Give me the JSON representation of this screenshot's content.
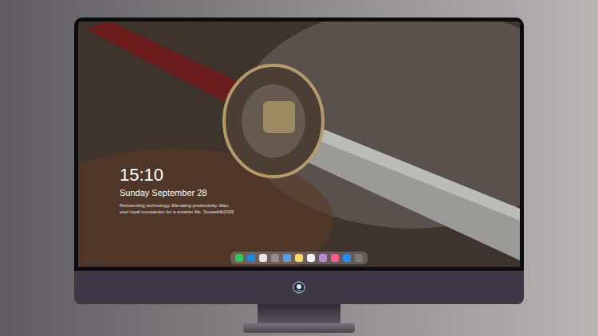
{
  "lock_screen": {
    "time": "15:10",
    "date": "Sunday September 28",
    "tagline": [
      "Reinventing technology. Elevating productivity. Mac,",
      "your loyal companion for a smarter life. Soosebib2026"
    ]
  },
  "dock": {
    "items": [
      {
        "color": "#34c759"
      },
      {
        "color": "#1e88e5"
      },
      {
        "color": "#e6e6e6"
      },
      {
        "color": "#8e8e93"
      },
      {
        "color": "#5aa0e0"
      },
      {
        "color": "#f5d76e"
      },
      {
        "color": "#f2f2f2"
      },
      {
        "color": "#b98ad8"
      },
      {
        "color": "#fa5a8c"
      },
      {
        "color": "#2a8cf0"
      },
      {
        "color": "#7a7a7e"
      }
    ]
  }
}
